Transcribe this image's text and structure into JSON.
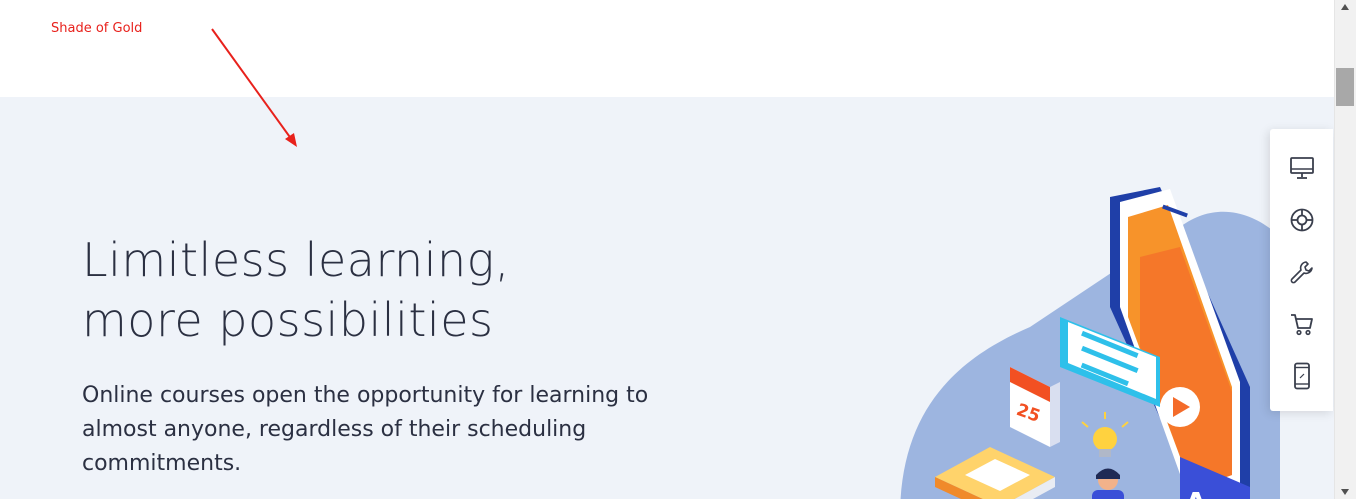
{
  "annotation": {
    "label": "Shade of Gold"
  },
  "hero": {
    "title_line1": "Limitless learning,",
    "title_line2": "more possibilities",
    "subtitle": "Online courses open the opportunity for learning to almost anyone, regardless of their scheduling commitments.",
    "calendar_day": "25"
  },
  "side_toolbar": {
    "items": [
      {
        "icon": "monitor-icon"
      },
      {
        "icon": "lifebuoy-icon"
      },
      {
        "icon": "wrench-icon"
      },
      {
        "icon": "cart-icon"
      },
      {
        "icon": "mobile-icon"
      }
    ]
  },
  "colors": {
    "annotation": "#e8211c",
    "hero_background": "#eff3f9",
    "text": "#2b3042",
    "accent_orange": "#f57c22",
    "accent_blue": "#3a4fd8"
  }
}
